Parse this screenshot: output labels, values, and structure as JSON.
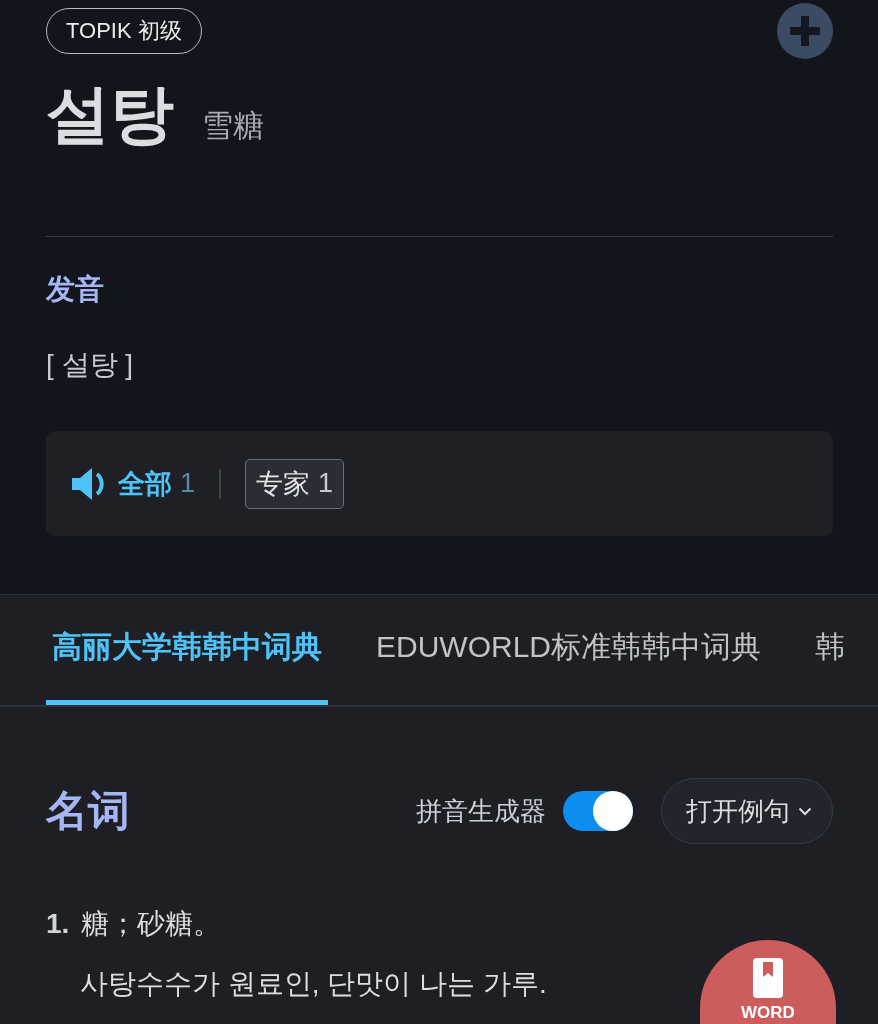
{
  "header": {
    "level_badge": "TOPIK 初级",
    "headword": "설탕",
    "hanja": "雪糖"
  },
  "pronunciation": {
    "heading": "发音",
    "text": "[ 설탕 ]",
    "audio_filters": [
      {
        "label": "全部",
        "count": "1",
        "selected": true
      },
      {
        "label": "专家",
        "count": "1",
        "selected": false
      }
    ]
  },
  "dictionary_tabs": [
    {
      "label": "高丽大学韩韩中词典",
      "selected": true
    },
    {
      "label": "EDUWORLD标准韩韩中词典",
      "selected": false
    },
    {
      "label": "韩",
      "selected": false
    }
  ],
  "entry": {
    "part_of_speech": "名词",
    "pinyin_toggle": {
      "label": "拼音生成器",
      "on": true
    },
    "examples_button": "打开例句",
    "senses": [
      {
        "number": "1.",
        "chinese": "糖；砂糖。",
        "korean": "사탕수수가 원료인, 단맛이 나는 가루."
      }
    ]
  },
  "word_button": {
    "label": "WORD"
  }
}
